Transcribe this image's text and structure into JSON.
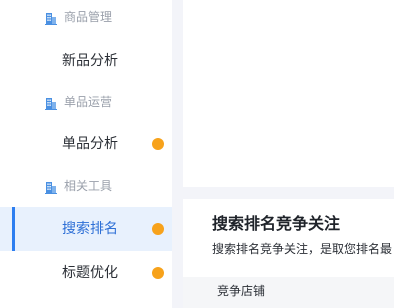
{
  "sidebar": {
    "groups": [
      {
        "label": "商品管理",
        "icon": "building-icon",
        "items": [
          {
            "label": "新品分析",
            "badge": false
          }
        ]
      },
      {
        "label": "单品运营",
        "icon": "building-icon",
        "items": [
          {
            "label": "单品分析",
            "badge": true
          }
        ]
      },
      {
        "label": "相关工具",
        "icon": "building-icon",
        "items": [
          {
            "label": "搜索排名",
            "badge": true,
            "active": true
          },
          {
            "label": "标题优化",
            "badge": true
          }
        ]
      }
    ]
  },
  "main": {
    "card": {
      "title": "搜索排名竞争关注",
      "description": "搜索排名竞争关注，是取您排名最",
      "tabs": [
        {
          "label": "竞争店铺"
        }
      ]
    }
  },
  "colors": {
    "accent": "#2d7ef0",
    "active_bg": "#e8f1fd",
    "badge": "#f7a21b",
    "icon": "#4a90e2"
  }
}
